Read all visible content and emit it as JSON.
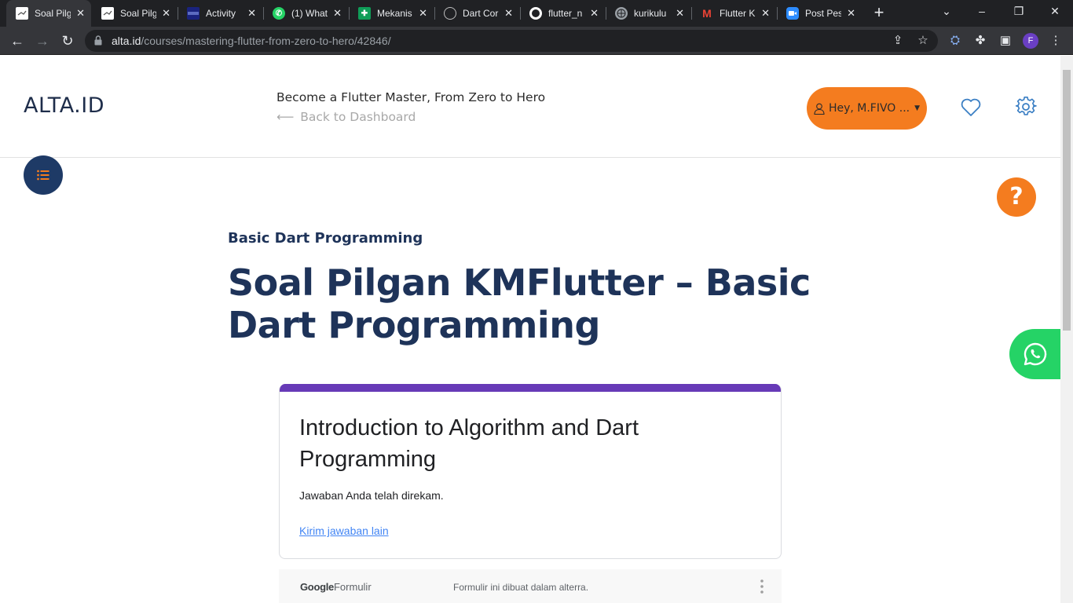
{
  "browser": {
    "tabs": [
      {
        "title": "Soal Pilg",
        "favicon": "alta-favicon",
        "active": true
      },
      {
        "title": "Soal Pilg",
        "favicon": "alta-favicon",
        "active": false
      },
      {
        "title": "Activity",
        "favicon": "activity-favicon",
        "active": false
      },
      {
        "title": "(1) What",
        "favicon": "whatsapp-favicon",
        "active": false
      },
      {
        "title": "Mekanis",
        "favicon": "sheets-favicon",
        "active": false
      },
      {
        "title": "Dart Cor",
        "favicon": "dart-favicon",
        "active": false
      },
      {
        "title": "flutter_n",
        "favicon": "github-favicon",
        "active": false
      },
      {
        "title": "kurikulu",
        "favicon": "globe-favicon",
        "active": false
      },
      {
        "title": "Flutter K",
        "favicon": "gmail-favicon",
        "active": false
      },
      {
        "title": "Post Pes",
        "favicon": "zoom-favicon",
        "active": false
      }
    ],
    "url_host": "alta.id",
    "url_path": "/courses/mastering-flutter-from-zero-to-hero/42846/",
    "profile_initial": "F"
  },
  "header": {
    "logo": "ALTA.ID",
    "course_title": "Become a Flutter Master, From Zero to Hero",
    "back_label": "Back to Dashboard",
    "user_label": "Hey, M.FIVO ..."
  },
  "lesson": {
    "section": "Basic Dart Programming",
    "title": "Soal Pilgan KMFlutter – Basic Dart Programming"
  },
  "form": {
    "title": "Introduction to Algorithm and Dart Programming",
    "message": "Jawaban Anda telah direkam.",
    "link": "Kirim jawaban lain",
    "footer_brand_google": "Google",
    "footer_brand_forms": "Formulir",
    "footer_note": "Formulir ini dibuat dalam alterra.",
    "accent": "#673ab7"
  },
  "colors": {
    "brand_navy": "#1e3359",
    "brand_orange": "#f47c1f",
    "whatsapp_green": "#25d366"
  },
  "help_symbol": "?"
}
